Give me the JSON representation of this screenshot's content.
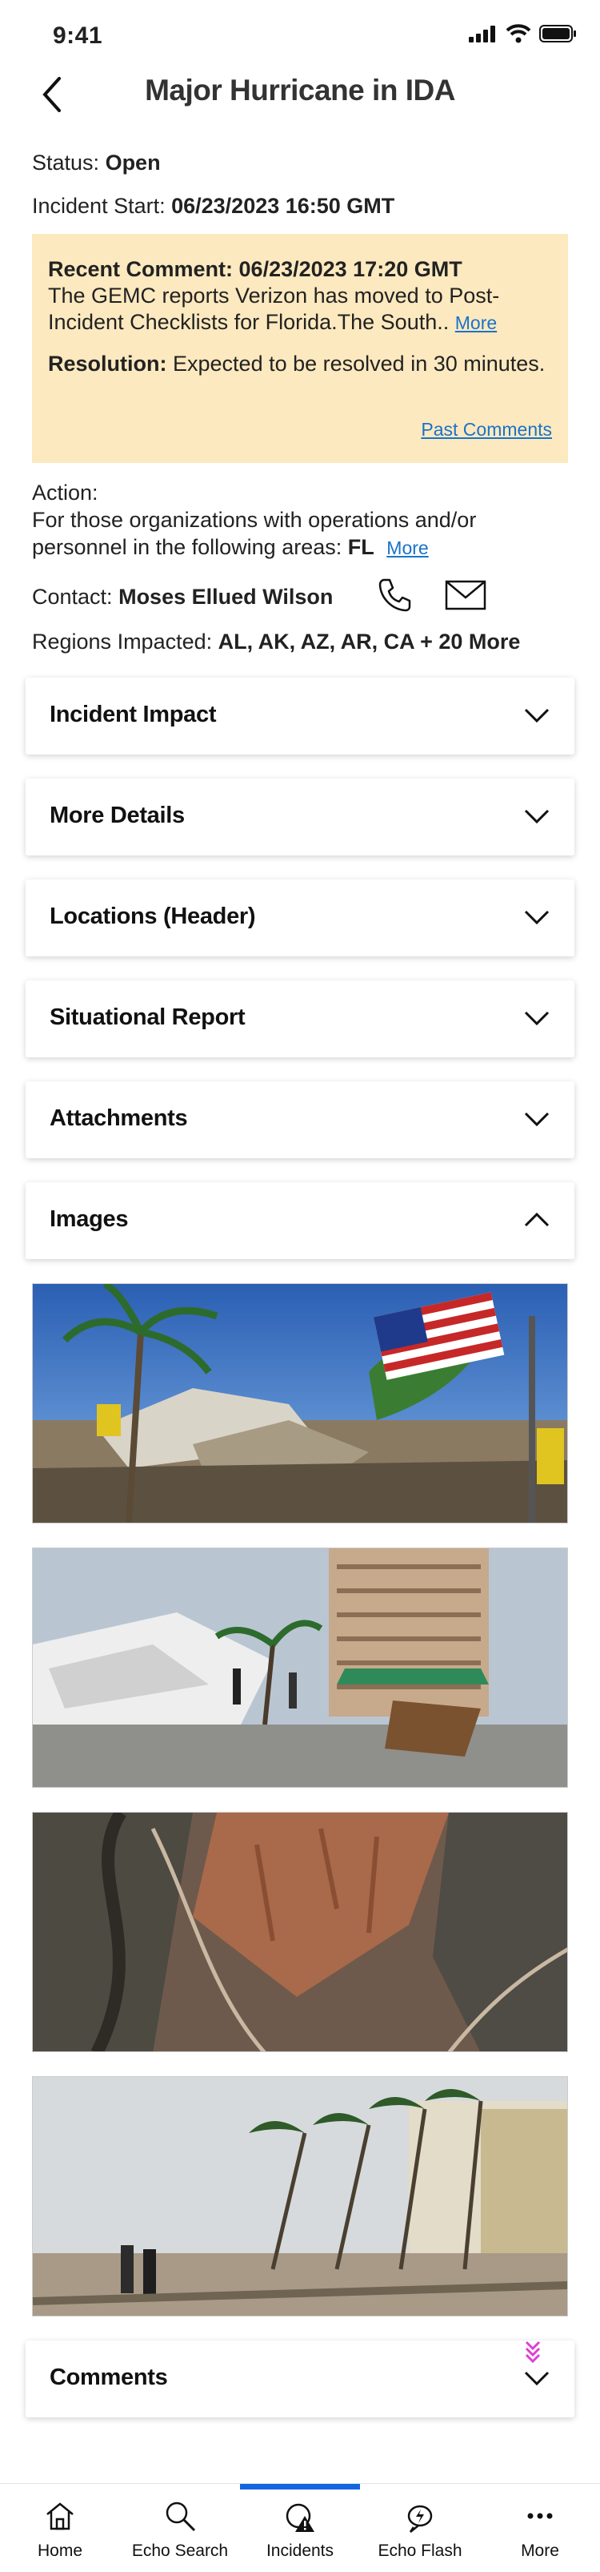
{
  "status_bar": {
    "time": "9:41"
  },
  "header": {
    "title": "Major Hurricane in IDA"
  },
  "status": {
    "label": "Status:",
    "value": "Open"
  },
  "incident_start": {
    "label": "Incident Start:",
    "value": "06/23/2023 16:50 GMT"
  },
  "recent_comment": {
    "label": "Recent Comment: 06/23/2023 17:20 GMT",
    "text": "The GEMC reports Verizon has moved to Post-Incident Checklists for Florida.The South..",
    "more": "More",
    "resolution_label": "Resolution:",
    "resolution_text": "Expected to be resolved in 30 minutes.",
    "past_comments": "Past Comments"
  },
  "action": {
    "label": "Action:",
    "text": "For those organizations with operations and/or personnel in the following areas:",
    "areas": "FL",
    "more": "More"
  },
  "contact": {
    "label": "Contact:",
    "name": "Moses Ellued Wilson"
  },
  "regions": {
    "label": "Regions Impacted:",
    "value": "AL, AK, AZ, AR, CA + 20 More"
  },
  "sections": [
    {
      "label": "Incident Impact",
      "expanded": false
    },
    {
      "label": "More Details",
      "expanded": false
    },
    {
      "label": "Locations (Header)",
      "expanded": false
    },
    {
      "label": "Situational Report",
      "expanded": false
    },
    {
      "label": "Attachments",
      "expanded": false
    },
    {
      "label": "Images",
      "expanded": true
    }
  ],
  "images": [
    {
      "name": "hurricane-damage-flag-photo"
    },
    {
      "name": "damaged-boats-marina-photo"
    },
    {
      "name": "aerial-canyon-road-photo"
    },
    {
      "name": "storm-palm-trees-beach-photo"
    }
  ],
  "comments_section": {
    "label": "Comments",
    "expanded": false
  },
  "tabbar": {
    "tabs": [
      {
        "label": "Home",
        "icon": "home-icon"
      },
      {
        "label": "Echo Search",
        "icon": "search-icon"
      },
      {
        "label": "Incidents",
        "icon": "incident-alert-icon",
        "active": true
      },
      {
        "label": "Echo Flash",
        "icon": "echo-flash-icon"
      },
      {
        "label": "More",
        "icon": "more-dots-icon"
      }
    ]
  },
  "colors": {
    "comment_bg": "#fde9bf",
    "link": "#1a73c8",
    "active_tab": "#1565e0",
    "scroll_hint": "#e040d0"
  }
}
